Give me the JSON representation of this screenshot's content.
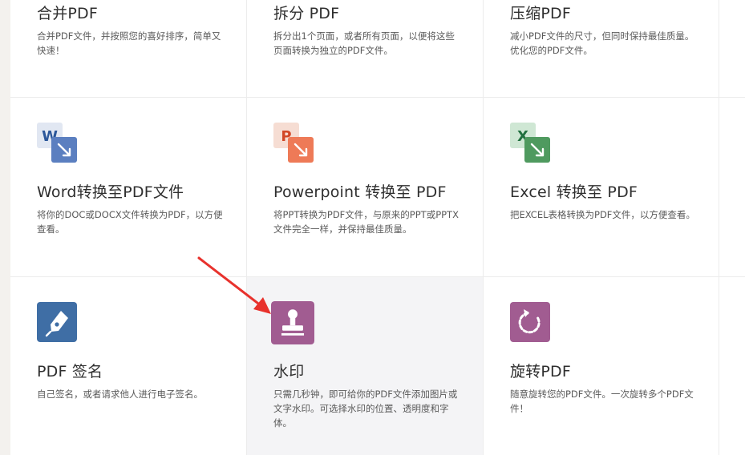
{
  "tools": [
    {
      "title": "合并PDF",
      "desc": "合并PDF文件，并按照您的喜好排序，简单又快速！"
    },
    {
      "title": "拆分 PDF",
      "desc": "拆分出1个页面，或者所有页面，以便将这些页面转换为独立的PDF文件。"
    },
    {
      "title": "压缩PDF",
      "desc": "减小PDF文件的尺寸，但同时保持最佳质量。优化您的PDF文件。"
    },
    {
      "title": "Word转换至PDF文件",
      "desc": "将你的DOC或DOCX文件转换为PDF，以方便查看。",
      "icon_letter": "W"
    },
    {
      "title": "Powerpoint 转换至 PDF",
      "desc": "将PPT转换为PDF文件，与原来的PPT或PPTX文件完全一样，并保持最佳质量。",
      "icon_letter": "P"
    },
    {
      "title": "Excel 转换至 PDF",
      "desc": "把EXCEL表格转换为PDF文件，以方便查看。",
      "icon_letter": "X"
    },
    {
      "title": "PDF 签名",
      "desc": "自己签名，或者请求他人进行电子签名。"
    },
    {
      "title": "水印",
      "desc": "只需几秒钟，即可给你的PDF文件添加图片或文字水印。可选择水印的位置、透明度和字体。"
    },
    {
      "title": "旋转PDF",
      "desc": "随意旋转您的PDF文件。一次旋转多个PDF文件！"
    }
  ],
  "colors": {
    "word": "#2b579a",
    "word_light": "#e1e7f2",
    "powerpoint": "#e0502f",
    "powerpoint_light": "#f6ddd3",
    "excel": "#21703f",
    "excel_light": "#cfe7d4",
    "sign": "#3f6ea5",
    "watermark": "#a15c91",
    "rotate": "#a15c91",
    "annotation_arrow": "#e8322d"
  },
  "icons": [
    "word-to-pdf-icon",
    "powerpoint-to-pdf-icon",
    "excel-to-pdf-icon",
    "pen-sign-icon",
    "stamp-watermark-icon",
    "rotate-icon"
  ]
}
